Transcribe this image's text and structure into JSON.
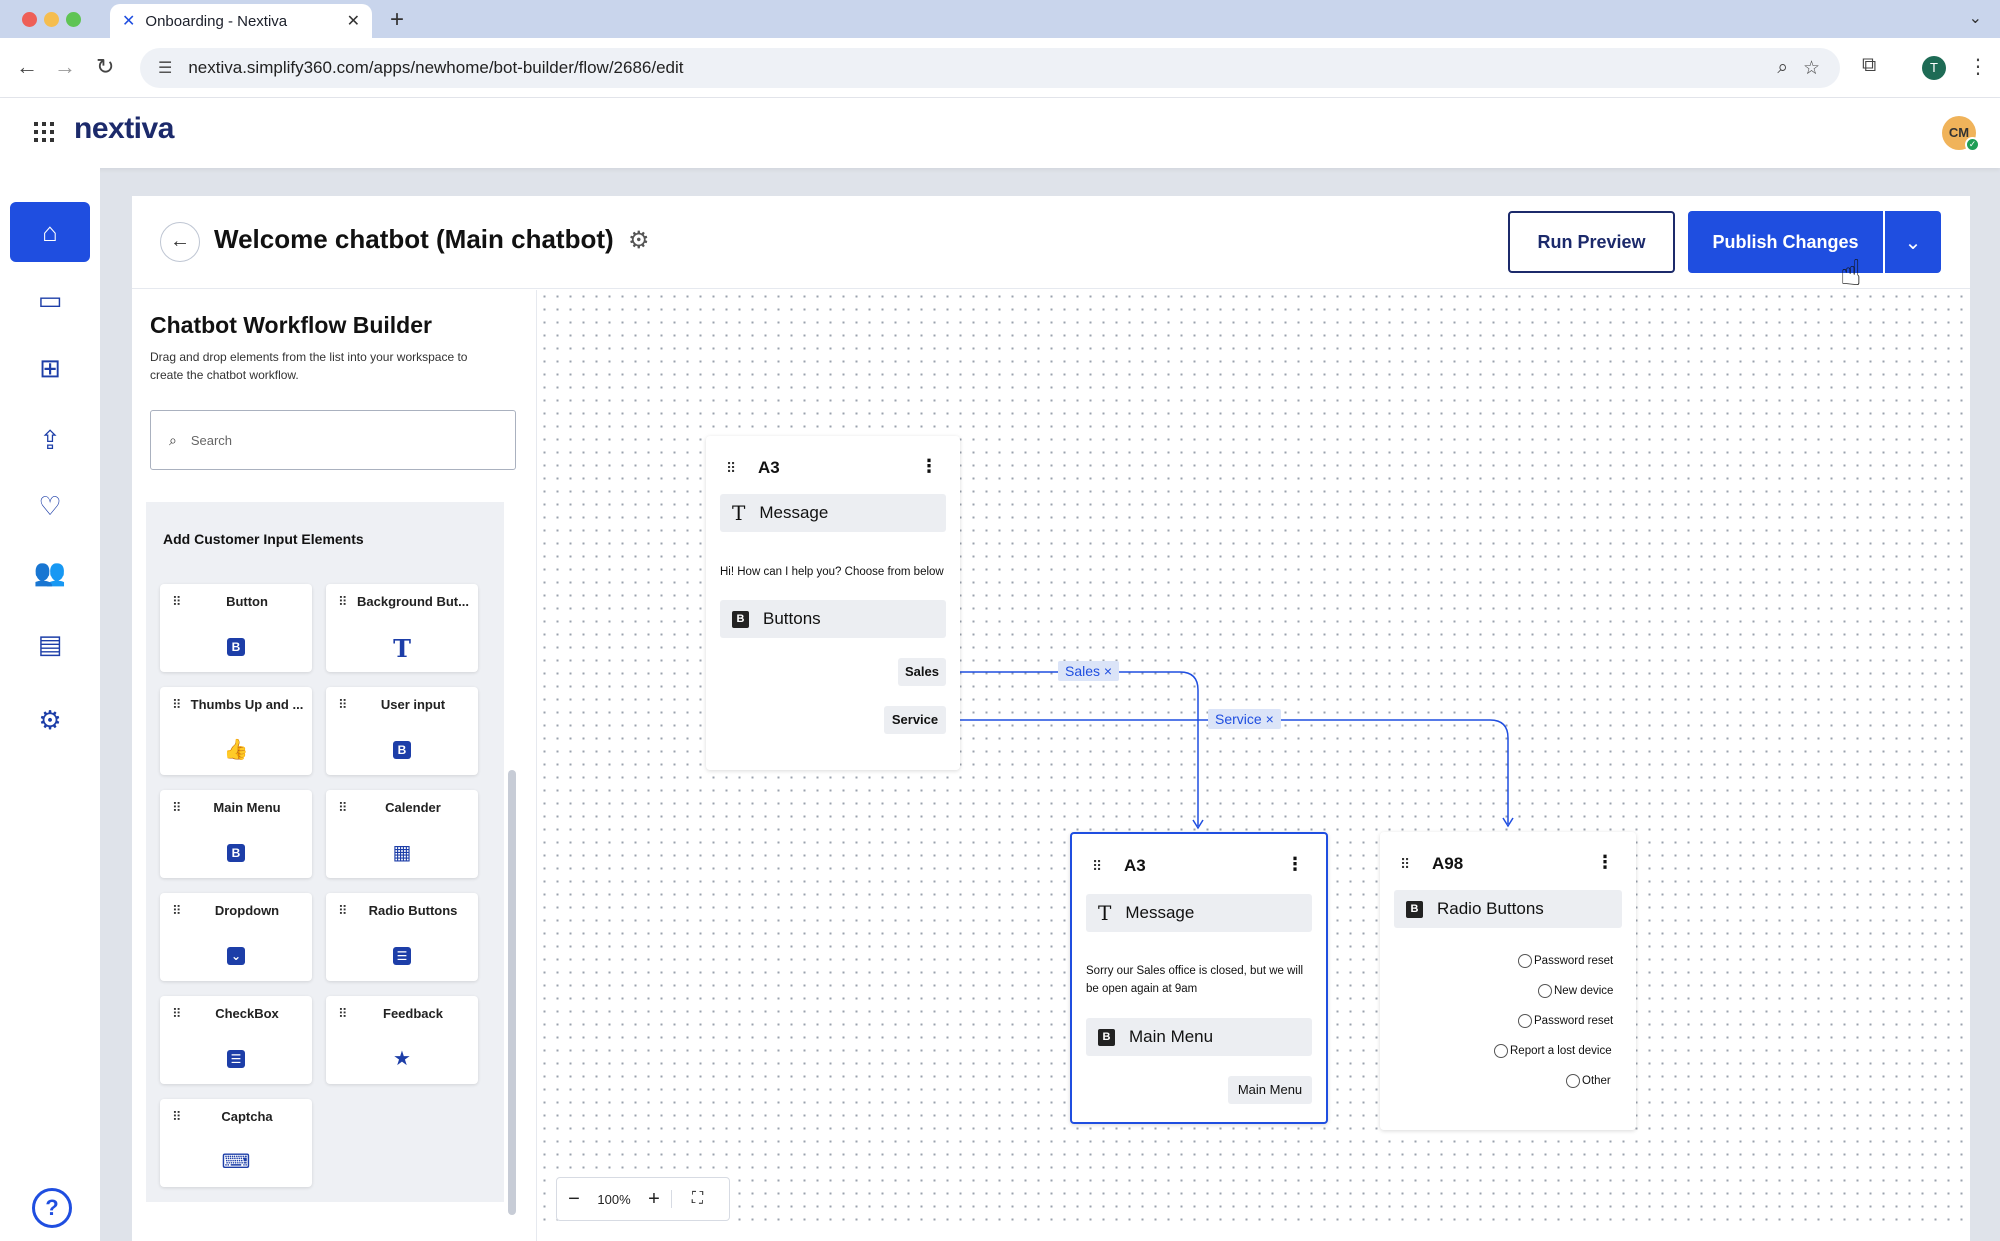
{
  "browser": {
    "tab_title": "Onboarding - Nextiva",
    "url": "nextiva.simplify360.com/apps/newhome/bot-builder/flow/2686/edit",
    "profile_initial": "T"
  },
  "app": {
    "brand": "nextiva",
    "avatar_initials": "CM"
  },
  "header": {
    "title": "Welcome chatbot (Main chatbot)",
    "run_preview_label": "Run Preview",
    "publish_label": "Publish Changes"
  },
  "builder": {
    "title": "Chatbot Workflow Builder",
    "subtitle": "Drag and drop elements from the list into your workspace to create the chatbot workflow.",
    "search_placeholder": "Search",
    "section_title": "Add Customer Input Elements",
    "elements": [
      {
        "label": "Button",
        "icon": "button-icon"
      },
      {
        "label": "Background But...",
        "icon": "text-icon"
      },
      {
        "label": "Thumbs Up and ...",
        "icon": "thumbs-up-icon"
      },
      {
        "label": "User input",
        "icon": "button-icon"
      },
      {
        "label": "Main Menu",
        "icon": "button-icon"
      },
      {
        "label": "Calender",
        "icon": "calendar-icon"
      },
      {
        "label": "Dropdown",
        "icon": "dropdown-icon"
      },
      {
        "label": "Radio Buttons",
        "icon": "list-icon"
      },
      {
        "label": "CheckBox",
        "icon": "checklist-icon"
      },
      {
        "label": "Feedback",
        "icon": "star-icon"
      },
      {
        "label": "Captcha",
        "icon": "keyboard-icon"
      }
    ]
  },
  "canvas": {
    "zoom": "100%",
    "edges": [
      {
        "label": "Sales ×"
      },
      {
        "label": "Service ×"
      }
    ],
    "nodes": [
      {
        "id": "A3",
        "message_block": "Message",
        "message_text": "Hi! How can I help you? Choose from below",
        "buttons_block": "Buttons",
        "buttons": [
          "Sales",
          "Service"
        ]
      },
      {
        "id": "A3",
        "message_block": "Message",
        "message_text": "Sorry our Sales office is closed, but we will be open again at 9am",
        "menu_block": "Main Menu",
        "buttons": [
          "Main Menu"
        ]
      },
      {
        "id": "A98",
        "block": "Radio Buttons",
        "options": [
          "Password reset",
          "New device",
          "Password reset",
          "Report a lost device",
          "Other"
        ]
      }
    ]
  },
  "colors": {
    "accent": "#1f4ee0",
    "brand_navy": "#1c2a6b"
  }
}
